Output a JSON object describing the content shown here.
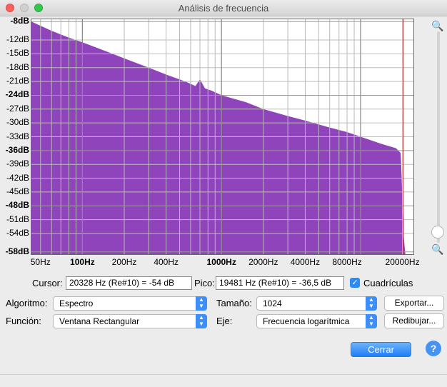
{
  "window": {
    "title": "Análisis de frecuencia"
  },
  "chart_data": {
    "type": "area",
    "xscale": "log",
    "x_ticks": [
      {
        "v": 50,
        "label": "50Hz",
        "bold": false
      },
      {
        "v": 100,
        "label": "100Hz",
        "bold": true
      },
      {
        "v": 200,
        "label": "200Hz",
        "bold": false
      },
      {
        "v": 400,
        "label": "400Hz",
        "bold": false
      },
      {
        "v": 1000,
        "label": "1000Hz",
        "bold": true
      },
      {
        "v": 2000,
        "label": "2000Hz",
        "bold": false
      },
      {
        "v": 4000,
        "label": "4000Hz",
        "bold": false
      },
      {
        "v": 8000,
        "label": "8000Hz",
        "bold": false
      },
      {
        "v": 20000,
        "label": "20000Hz",
        "bold": false
      }
    ],
    "y_ticks": [
      {
        "v": -8,
        "label": "-8dB",
        "bold": true
      },
      {
        "v": -12,
        "label": "-12dB",
        "bold": false
      },
      {
        "v": -15,
        "label": "-15dB",
        "bold": false
      },
      {
        "v": -18,
        "label": "-18dB",
        "bold": false
      },
      {
        "v": -21,
        "label": "-21dB",
        "bold": false
      },
      {
        "v": -24,
        "label": "-24dB",
        "bold": true
      },
      {
        "v": -27,
        "label": "-27dB",
        "bold": false
      },
      {
        "v": -30,
        "label": "-30dB",
        "bold": false
      },
      {
        "v": -33,
        "label": "-33dB",
        "bold": false
      },
      {
        "v": -36,
        "label": "-36dB",
        "bold": true
      },
      {
        "v": -39,
        "label": "-39dB",
        "bold": false
      },
      {
        "v": -42,
        "label": "-42dB",
        "bold": false
      },
      {
        "v": -45,
        "label": "-45dB",
        "bold": false
      },
      {
        "v": -48,
        "label": "-48dB",
        "bold": true
      },
      {
        "v": -51,
        "label": "-51dB",
        "bold": false
      },
      {
        "v": -54,
        "label": "-54dB",
        "bold": false
      },
      {
        "v": -58,
        "label": "-58dB",
        "bold": true
      }
    ],
    "xlim": [
      43,
      24000
    ],
    "ylim": [
      -58.5,
      -7.5
    ],
    "grid": true,
    "fill_color": "#8f44bb",
    "cursor_color": "#e22222",
    "cursor_x": 20328,
    "series": [
      {
        "x": [
          43,
          60,
          80,
          100,
          150,
          200,
          300,
          400,
          550,
          650,
          700,
          760,
          850,
          1000,
          1500,
          2000,
          3000,
          4000,
          6000,
          8000,
          10000,
          14000,
          18000,
          19400,
          19600,
          20328,
          21000,
          24000
        ],
        "y": [
          -8,
          -10,
          -11.5,
          -12.5,
          -14.5,
          -16,
          -18,
          -19.5,
          -21,
          -22,
          -20.5,
          -22.5,
          -23,
          -24,
          -25.5,
          -27,
          -28.5,
          -29.5,
          -31,
          -32,
          -33,
          -34.5,
          -35.5,
          -36.5,
          -39,
          -54,
          -58.5,
          -58.5
        ]
      }
    ]
  },
  "cursor": {
    "label": "Cursor:",
    "value": "20328 Hz (Re#10) = -54 dB"
  },
  "peak": {
    "label": "Pico:",
    "value": "19481 Hz (Re#10) = -36,5 dB"
  },
  "grid_toggle": {
    "label": "Cuadrículas",
    "checked": true
  },
  "algorithm": {
    "label": "Algoritmo:",
    "value": "Espectro"
  },
  "size": {
    "label": "Tamaño:",
    "value": "1024"
  },
  "function": {
    "label": "Función:",
    "value": "Ventana Rectangular"
  },
  "axis": {
    "label": "Eje:",
    "value": "Frecuencia logarítmica"
  },
  "buttons": {
    "export": "Exportar...",
    "redraw": "Redibujar...",
    "close": "Cerrar",
    "help": "?"
  },
  "colors": {
    "accent": "#2d8bf7",
    "close_window": "#fc605c",
    "maximize": "#34c84a"
  }
}
